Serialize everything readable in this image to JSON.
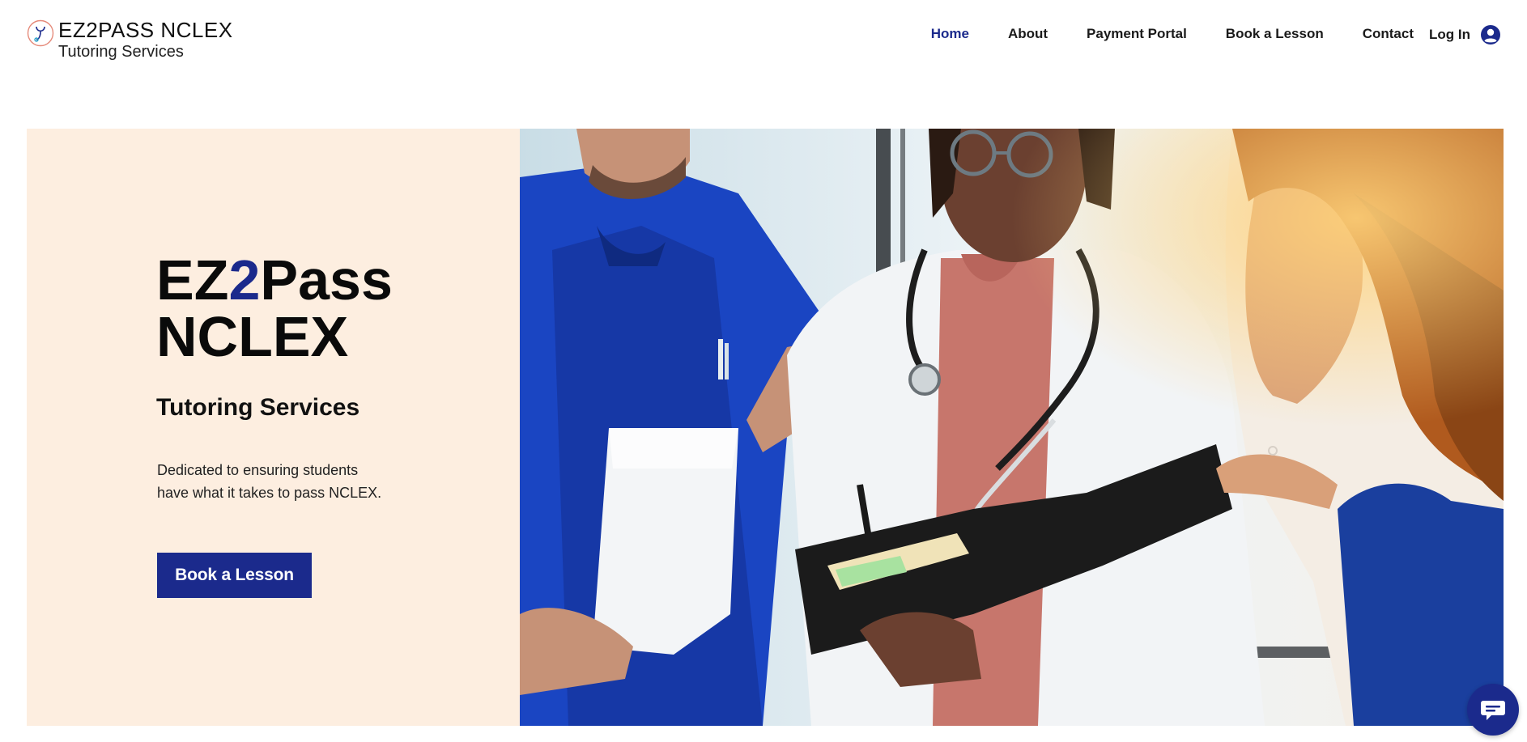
{
  "header": {
    "brand": {
      "name": "EZ2PASS NCLEX",
      "subtitle": "Tutoring Services",
      "logo_icon": "stethoscope-circle-icon"
    },
    "nav": {
      "items": [
        {
          "label": "Home",
          "active": true
        },
        {
          "label": "About",
          "active": false
        },
        {
          "label": "Payment Portal",
          "active": false
        },
        {
          "label": "Book a Lesson",
          "active": false
        },
        {
          "label": "Contact",
          "active": false
        }
      ]
    },
    "login": {
      "label": "Log In",
      "icon": "account-circle-icon"
    }
  },
  "hero": {
    "title_part1": "EZ",
    "title_accent": "2",
    "title_part2": "Pass",
    "title_line2": "NCLEX",
    "subtitle": "Tutoring Services",
    "description": "Dedicated to ensuring students have what it takes to pass NCLEX.",
    "cta_label": "Book a Lesson",
    "image_icon": "medical-team-photo"
  },
  "chat": {
    "icon": "chat-bubble-icon"
  },
  "colors": {
    "accent": "#1b2a8c",
    "hero_bg": "#fdeee0",
    "text": "#111111"
  }
}
